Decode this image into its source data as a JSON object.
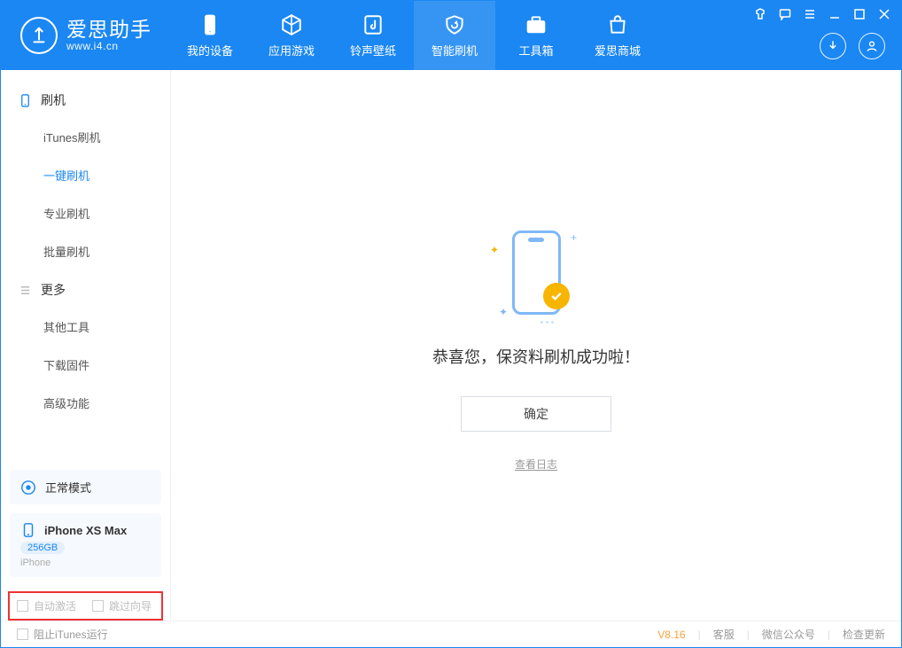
{
  "app": {
    "title": "爱思助手",
    "url": "www.i4.cn"
  },
  "header_tabs": [
    {
      "label": "我的设备"
    },
    {
      "label": "应用游戏"
    },
    {
      "label": "铃声壁纸"
    },
    {
      "label": "智能刷机"
    },
    {
      "label": "工具箱"
    },
    {
      "label": "爱思商城"
    }
  ],
  "sidebar": {
    "group1": {
      "title": "刷机"
    },
    "items1": [
      {
        "label": "iTunes刷机"
      },
      {
        "label": "一键刷机"
      },
      {
        "label": "专业刷机"
      },
      {
        "label": "批量刷机"
      }
    ],
    "group2": {
      "title": "更多"
    },
    "items2": [
      {
        "label": "其他工具"
      },
      {
        "label": "下载固件"
      },
      {
        "label": "高级功能"
      }
    ]
  },
  "device": {
    "mode": "正常模式",
    "name": "iPhone XS Max",
    "capacity": "256GB",
    "type": "iPhone"
  },
  "options": {
    "auto_activate": "自动激活",
    "skip_wizard": "跳过向导"
  },
  "main": {
    "success": "恭喜您，保资料刷机成功啦！",
    "ok": "确定",
    "view_log": "查看日志"
  },
  "footer": {
    "block_itunes": "阻止iTunes运行",
    "version": "V8.16",
    "svc": "客服",
    "wechat": "微信公众号",
    "update": "检查更新"
  }
}
